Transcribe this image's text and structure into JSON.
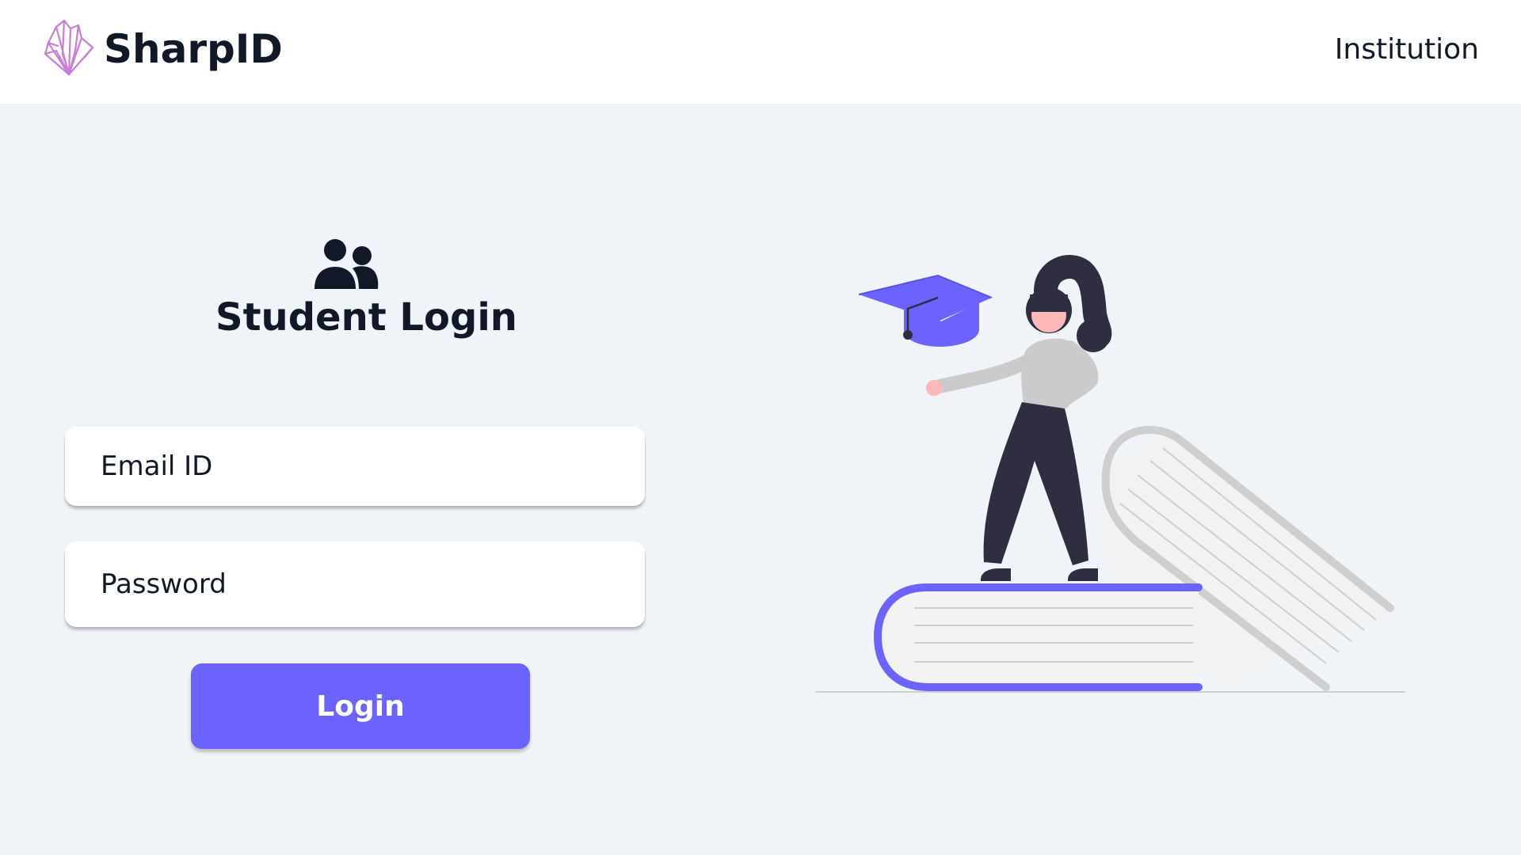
{
  "navbar": {
    "brand_name": "SharpID",
    "logo_icon": "crystal-logo-icon",
    "nav_link": "Institution"
  },
  "login": {
    "icon": "users-icon",
    "title": "Student Login",
    "email": {
      "placeholder": "Email ID",
      "value": ""
    },
    "password": {
      "placeholder": "Password",
      "value": ""
    },
    "submit_label": "Login"
  },
  "illustration": {
    "name": "student-on-books-illustration"
  },
  "colors": {
    "accent": "#6c63ff",
    "page_background": "#f0f3f8",
    "navbar_background": "#ffffff",
    "text_primary": "#111827",
    "book_gray": "#cfcfcf",
    "figure_dark": "#2f2e41",
    "figure_shirt": "#cbcbcb",
    "skin": "#ffb8b8",
    "logo": "#c77dd9"
  }
}
